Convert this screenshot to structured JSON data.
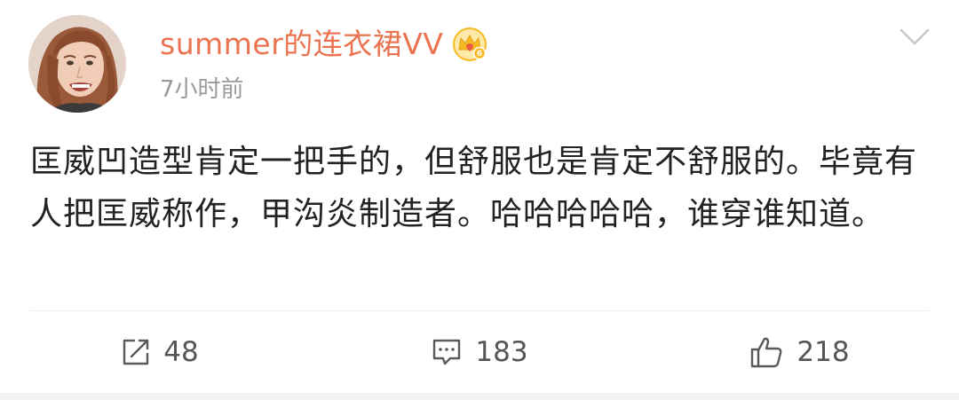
{
  "post": {
    "username": "summer的连衣裙VV",
    "timestamp": "7小时前",
    "content": "匡威凹造型肯定一把手的，但舒服也是肯定不舒服的。毕竟有人把匡威称作，甲沟炎制造者。哈哈哈哈哈，谁穿谁知道。"
  },
  "badge": {
    "icon": "crown-vip-icon",
    "level": "6",
    "color": "#f5b923"
  },
  "actions": {
    "repost": {
      "icon": "repost-icon",
      "count": "48"
    },
    "comment": {
      "icon": "comment-icon",
      "count": "183"
    },
    "like": {
      "icon": "thumbs-up-icon",
      "count": "218"
    }
  },
  "colors": {
    "username": "#eb7350",
    "timestamp": "#9a9a9a",
    "text": "#222222",
    "icon": "#5a5a5a"
  }
}
